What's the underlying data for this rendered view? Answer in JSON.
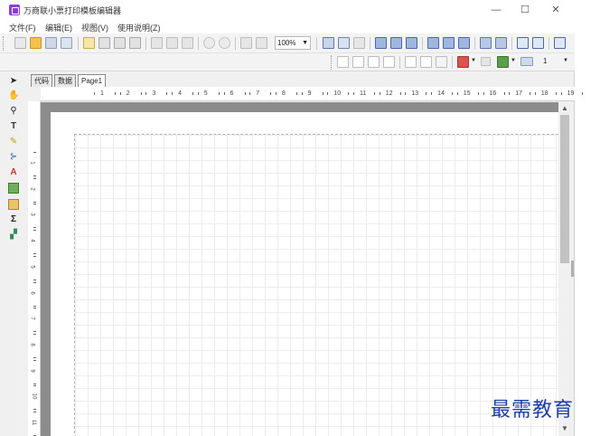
{
  "window": {
    "title": "万商联小票打印模板编辑器",
    "controls": {
      "minimize": "—",
      "maximize": "☐",
      "close": "✕"
    }
  },
  "menubar": {
    "items": [
      "文件(F)",
      "编辑(E)",
      "视图(V)",
      "使用说明(Z)"
    ]
  },
  "toolbar": {
    "zoom_value": "100%",
    "line_width_value": "1"
  },
  "tabs": [
    {
      "label": "代码"
    },
    {
      "label": "数据"
    },
    {
      "label": "Page1",
      "active": true
    }
  ],
  "ruler": {
    "horizontal": [
      "1",
      "2",
      "3",
      "4",
      "5",
      "6",
      "7",
      "8",
      "9",
      "10",
      "11",
      "12",
      "13",
      "14",
      "15",
      "16",
      "17",
      "18",
      "19"
    ],
    "vertical": [
      "1",
      "2",
      "3",
      "4",
      "5",
      "6",
      "7",
      "8",
      "9",
      "10",
      "11"
    ]
  },
  "palette": {
    "tools": [
      "pointer-icon",
      "hand-icon",
      "zoom-icon",
      "text-icon",
      "brush-icon",
      "connector-icon",
      "font-a-icon",
      "image-icon",
      "barcode-icon",
      "sum-icon",
      "shapes-icon"
    ]
  },
  "watermark": "最需教育",
  "colors": {
    "accent": "#8b3fd6",
    "watermark": "#1f3fa8",
    "canvas_bg": "#8c8c8c"
  }
}
